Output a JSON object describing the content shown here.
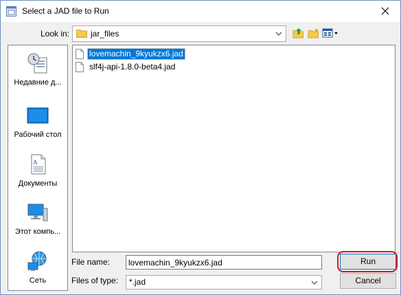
{
  "window": {
    "title": "Select a JAD file to Run",
    "close_glyph": "✕"
  },
  "look_in": {
    "label": "Look in:",
    "value": "jar_files"
  },
  "places": [
    {
      "label": "Недавние д...",
      "icon": "recent-places-icon"
    },
    {
      "label": "Рабочий стол",
      "icon": "desktop-icon"
    },
    {
      "label": "Документы",
      "icon": "documents-icon"
    },
    {
      "label": "Этот компь...",
      "icon": "this-pc-icon"
    },
    {
      "label": "Сеть",
      "icon": "network-icon"
    }
  ],
  "files": [
    {
      "name": "lovemachin_9kyukzx6.jad",
      "selected": true
    },
    {
      "name": "slf4j-api-1.8.0-beta4.jad",
      "selected": false
    }
  ],
  "file_name": {
    "label": "File name:",
    "value": "lovemachin_9kyukzx6.jad"
  },
  "file_type": {
    "label": "Files of type:",
    "value": "*.jad"
  },
  "buttons": {
    "run": "Run",
    "cancel": "Cancel"
  },
  "colors": {
    "selection": "#0078d7",
    "highlight_ring": "#d0191f",
    "folder": "#f5c94c"
  }
}
